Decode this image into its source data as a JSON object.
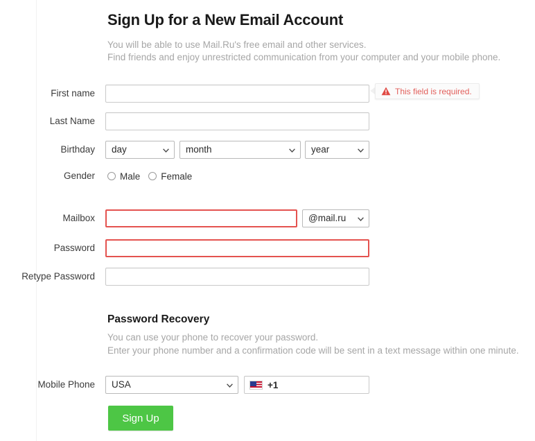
{
  "page": {
    "title": "Sign Up for a New Email Account",
    "intro_lines": [
      "You will be able to use Mail.Ru's free email and other services.",
      "Find friends and enjoy unrestricted communication from your computer and your mobile phone."
    ]
  },
  "form": {
    "first_name": {
      "label": "First name",
      "value": "",
      "placeholder": "",
      "state": "normal"
    },
    "last_name": {
      "label": "Last Name",
      "value": "",
      "placeholder": "",
      "state": "normal"
    },
    "birthday": {
      "label": "Birthday",
      "day": {
        "selected": "day",
        "options": [
          "day"
        ]
      },
      "month": {
        "selected": "month",
        "options": [
          "month"
        ]
      },
      "year": {
        "selected": "year",
        "options": [
          "year"
        ]
      }
    },
    "gender": {
      "label": "Gender",
      "options": [
        {
          "label": "Male",
          "selected": false
        },
        {
          "label": "Female",
          "selected": false
        }
      ]
    },
    "mailbox": {
      "label": "Mailbox",
      "value": "",
      "placeholder": "",
      "state": "error",
      "domain": {
        "selected": "@mail.ru",
        "options": [
          "@mail.ru"
        ]
      }
    },
    "password": {
      "label": "Password",
      "value": "",
      "placeholder": "",
      "state": "error"
    },
    "retype_password": {
      "label": "Retype Password",
      "value": "",
      "placeholder": "",
      "state": "normal"
    },
    "mobile_phone": {
      "label": "Mobile Phone",
      "country": {
        "selected": "USA",
        "options": [
          "USA"
        ]
      },
      "dial_code": "+1",
      "flag_icon": "us-flag-icon",
      "number_value": "",
      "number_placeholder": ""
    },
    "submit_label": "Sign Up"
  },
  "validation": {
    "first_name_error": {
      "text": "This field is required.",
      "icon": "warning-triangle-icon"
    }
  },
  "recovery": {
    "heading": "Password Recovery",
    "lines": [
      "You can use your phone to recover your password.",
      "Enter your phone number and a confirmation code will be sent in a text message within one minute."
    ]
  },
  "colors": {
    "error_border": "#e4524f",
    "error_text": "#e2605c",
    "submit_bg": "#4dc645",
    "muted_text": "#a6a6a6",
    "label_text": "#3b3b3b"
  },
  "icons": {
    "chevron_down": "chevron-down-icon"
  }
}
